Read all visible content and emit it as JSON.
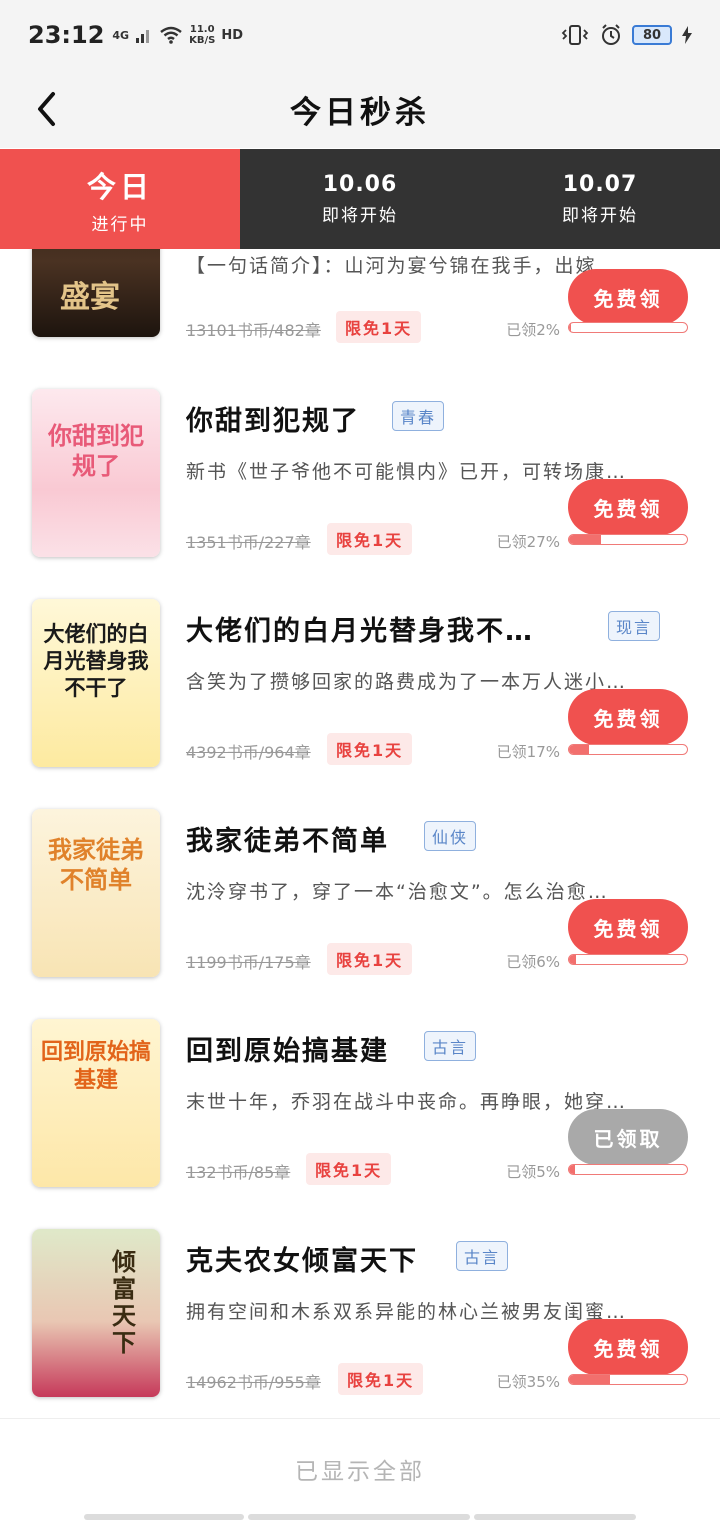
{
  "status_bar": {
    "time": "23:12",
    "network_type": "4G",
    "speed_value": "11.0",
    "speed_unit": "KB/S",
    "hd": "HD",
    "battery": "80"
  },
  "header": {
    "title": "今日秒杀"
  },
  "tabs": [
    {
      "date": "今日",
      "status": "进行中"
    },
    {
      "date": "10.06",
      "status": "即将开始"
    },
    {
      "date": "10.07",
      "status": "即将开始"
    }
  ],
  "books": [
    {
      "title": "",
      "genre": "",
      "description": "【一句话简介】：山河为宴兮锦在我手，出嫁…",
      "original_price": "13101书币/482章",
      "free_badge": "限免1天",
      "claimed_text": "已领2%",
      "claimed_progress": 0.02,
      "button": "免费领",
      "button_state": "available",
      "cover_text": "盛宴"
    },
    {
      "title": "你甜到犯规了",
      "genre": "青春",
      "description": "新书《世子爷他不可能惧内》已开，可转场康…",
      "original_price": "1351书币/227章",
      "free_badge": "限免1天",
      "claimed_text": "已领27%",
      "claimed_progress": 0.27,
      "button": "免费领",
      "button_state": "available",
      "cover_text": "你甜到犯规了"
    },
    {
      "title": "大佬们的白月光替身我不…",
      "genre": "现言",
      "description": "含笑为了攒够回家的路费成为了一本万人迷小…",
      "original_price": "4392书币/964章",
      "free_badge": "限免1天",
      "claimed_text": "已领17%",
      "claimed_progress": 0.17,
      "button": "免费领",
      "button_state": "available",
      "cover_text": "大佬们的白月光替身我不干了"
    },
    {
      "title": "我家徒弟不简单",
      "genre": "仙侠",
      "description": "沈泠穿书了，穿了一本“治愈文”。怎么治愈…",
      "original_price": "1199书币/175章",
      "free_badge": "限免1天",
      "claimed_text": "已领6%",
      "claimed_progress": 0.06,
      "button": "免费领",
      "button_state": "available",
      "cover_text": "我家徒弟不简单"
    },
    {
      "title": "回到原始搞基建",
      "genre": "古言",
      "description": "末世十年，乔羽在战斗中丧命。再睁眼，她穿…",
      "original_price": "132书币/85章",
      "free_badge": "限免1天",
      "claimed_text": "已领5%",
      "claimed_progress": 0.05,
      "button": "已领取",
      "button_state": "claimed",
      "cover_text": "回到原始搞基建"
    },
    {
      "title": "克夫农女倾富天下",
      "genre": "古言",
      "description": "拥有空间和木系双系异能的林心兰被男友闺蜜…",
      "original_price": "14962书币/955章",
      "free_badge": "限免1天",
      "claimed_text": "已领35%",
      "claimed_progress": 0.35,
      "button": "免费领",
      "button_state": "available",
      "cover_text": "倾富天下"
    }
  ],
  "footer": {
    "text": "已显示全部"
  },
  "colors": {
    "accent": "#f0514f",
    "tab_bar": "#333333",
    "claimed_button": "#a9a9a9",
    "genre_tag": "#5a86c8"
  }
}
